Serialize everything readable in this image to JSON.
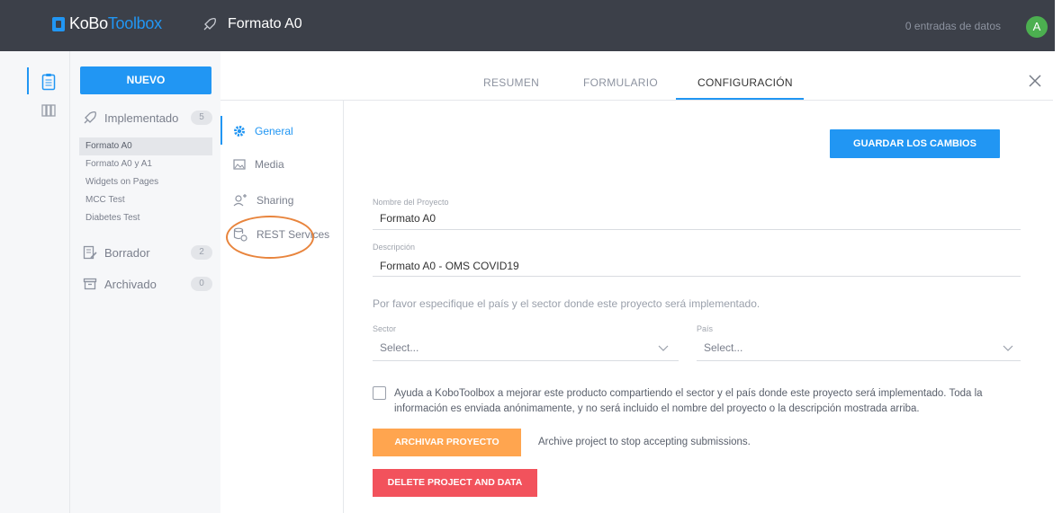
{
  "header": {
    "logo_ko": "KoBo",
    "logo_toolbox": "Toolbox",
    "project_title": "Formato A0",
    "entries_text": "0 entradas de datos",
    "avatar_letter": "A"
  },
  "drawer": {
    "new_button": "NUEVO",
    "categories": [
      {
        "label": "Implementado",
        "count": "5",
        "icon": "rocket-icon"
      },
      {
        "label": "Borrador",
        "count": "2",
        "icon": "draft-icon"
      },
      {
        "label": "Archivado",
        "count": "0",
        "icon": "archive-icon"
      }
    ],
    "projects": [
      "Formato A0",
      "Formato A0 y A1",
      "Widgets on Pages",
      "MCC Test",
      "Diabetes Test"
    ]
  },
  "tabs": [
    "RESUMEN",
    "FORMULARIO",
    "CONFIGURACIÓN"
  ],
  "subnav": [
    {
      "label": "General",
      "icon": "gear-icon"
    },
    {
      "label": "Media",
      "icon": "media-icon"
    },
    {
      "label": "Sharing",
      "icon": "add-user-icon"
    },
    {
      "label": "REST Services",
      "icon": "rest-services-icon"
    }
  ],
  "form": {
    "save_button": "GUARDAR LOS CAMBIOS",
    "name_label": "Nombre del Proyecto",
    "name_value": "Formato A0",
    "desc_label": "Descripción",
    "desc_value": "Formato A0 - OMS COVID19",
    "hint": "Por favor especifique el país y el sector donde este proyecto será implementado.",
    "sector_label": "Sector",
    "sector_placeholder": "Select...",
    "country_label": "País",
    "country_placeholder": "Select...",
    "consent_text": "Ayuda a KoboToolbox a mejorar este producto compartiendo el sector y el país donde este proyecto será implementado. Toda la información es enviada anónimamente, y no será incluido el nombre del proyecto o la descripción mostrada arriba.",
    "archive_button": "ARCHIVAR PROYECTO",
    "archive_note": "Archive project to stop accepting submissions.",
    "delete_button": "DELETE PROJECT AND DATA"
  },
  "colors": {
    "accent": "#2196f3",
    "topbar": "#3c4049",
    "archive": "#ffa54f",
    "delete": "#f2525c",
    "avatar": "#4caf50",
    "annotation": "#e8843c"
  }
}
